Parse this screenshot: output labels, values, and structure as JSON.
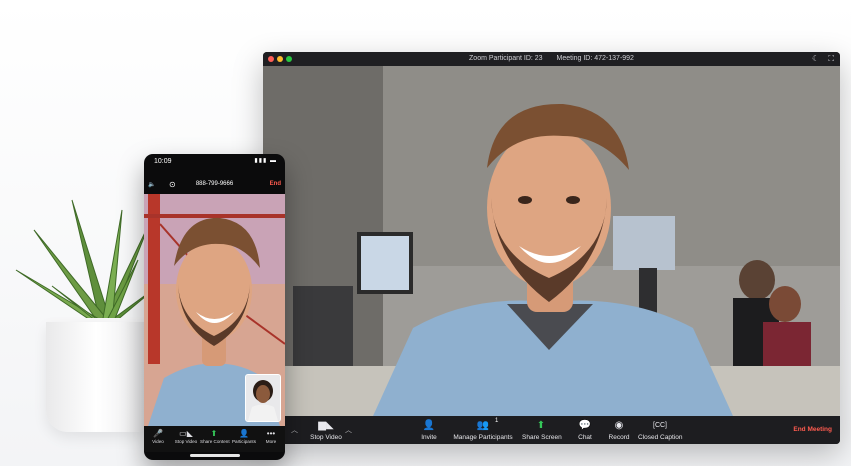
{
  "desktop": {
    "participant_id": "Zoom Participant ID: 23",
    "meeting_id": "Meeting ID: 472-137-992",
    "toolbar": {
      "stop_video": "Stop Video",
      "invite": "Invite",
      "manage_participants": "Manage Participants",
      "participant_count": "1",
      "share_screen": "Share Screen",
      "chat": "Chat",
      "record": "Record",
      "closed_caption": "Closed Caption",
      "end_meeting": "End Meeting"
    }
  },
  "phone": {
    "time": "10:09",
    "phone_number": "888-799-9666",
    "end_label": "End",
    "toolbar": {
      "video": "Video",
      "stop_video": "Stop Video",
      "share_content": "Share Content",
      "participants": "Participants",
      "more": "More"
    }
  },
  "colors": {
    "share_green": "#35c759",
    "end_red": "#ff5b4f",
    "toolbar_bg": "#1d1d20"
  },
  "icons": {
    "chevron": "chevron-up-icon",
    "camera": "video-camera-icon",
    "invite": "add-user-icon",
    "participants": "participants-icon",
    "share": "share-screen-icon",
    "chat": "chat-bubble-icon",
    "record": "record-icon",
    "cc": "closed-caption-icon",
    "mic": "microphone-icon",
    "more": "more-icon"
  }
}
